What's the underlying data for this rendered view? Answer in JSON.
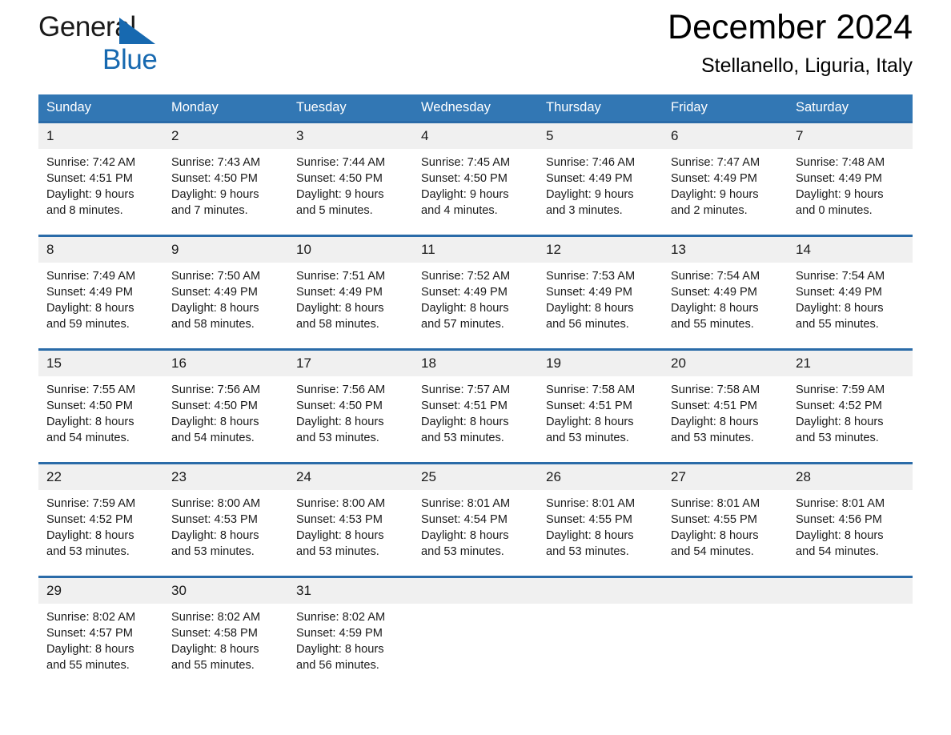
{
  "brand": {
    "name_top": "General",
    "name_bottom": "Blue",
    "triangle_color": "#1769b0",
    "text_color_top": "#1a1a1a",
    "text_color_bottom": "#1769b0"
  },
  "header": {
    "month_title": "December 2024",
    "location": "Stellanello, Liguria, Italy"
  },
  "theme": {
    "header_blue": "#3277b4",
    "cell_rule_blue": "#2a6ba8",
    "daynum_band": "#f0f0f0",
    "page_background": "#ffffff"
  },
  "calendar": {
    "weekday_headers": [
      "Sunday",
      "Monday",
      "Tuesday",
      "Wednesday",
      "Thursday",
      "Friday",
      "Saturday"
    ],
    "labels": {
      "sunrise_prefix": "Sunrise:",
      "sunset_prefix": "Sunset:",
      "daylight_prefix": "Daylight:"
    },
    "weeks": [
      [
        {
          "day": "1",
          "sunrise": "Sunrise: 7:42 AM",
          "sunset": "Sunset: 4:51 PM",
          "daylight_line1": "Daylight: 9 hours",
          "daylight_line2": "and 8 minutes."
        },
        {
          "day": "2",
          "sunrise": "Sunrise: 7:43 AM",
          "sunset": "Sunset: 4:50 PM",
          "daylight_line1": "Daylight: 9 hours",
          "daylight_line2": "and 7 minutes."
        },
        {
          "day": "3",
          "sunrise": "Sunrise: 7:44 AM",
          "sunset": "Sunset: 4:50 PM",
          "daylight_line1": "Daylight: 9 hours",
          "daylight_line2": "and 5 minutes."
        },
        {
          "day": "4",
          "sunrise": "Sunrise: 7:45 AM",
          "sunset": "Sunset: 4:50 PM",
          "daylight_line1": "Daylight: 9 hours",
          "daylight_line2": "and 4 minutes."
        },
        {
          "day": "5",
          "sunrise": "Sunrise: 7:46 AM",
          "sunset": "Sunset: 4:49 PM",
          "daylight_line1": "Daylight: 9 hours",
          "daylight_line2": "and 3 minutes."
        },
        {
          "day": "6",
          "sunrise": "Sunrise: 7:47 AM",
          "sunset": "Sunset: 4:49 PM",
          "daylight_line1": "Daylight: 9 hours",
          "daylight_line2": "and 2 minutes."
        },
        {
          "day": "7",
          "sunrise": "Sunrise: 7:48 AM",
          "sunset": "Sunset: 4:49 PM",
          "daylight_line1": "Daylight: 9 hours",
          "daylight_line2": "and 0 minutes."
        }
      ],
      [
        {
          "day": "8",
          "sunrise": "Sunrise: 7:49 AM",
          "sunset": "Sunset: 4:49 PM",
          "daylight_line1": "Daylight: 8 hours",
          "daylight_line2": "and 59 minutes."
        },
        {
          "day": "9",
          "sunrise": "Sunrise: 7:50 AM",
          "sunset": "Sunset: 4:49 PM",
          "daylight_line1": "Daylight: 8 hours",
          "daylight_line2": "and 58 minutes."
        },
        {
          "day": "10",
          "sunrise": "Sunrise: 7:51 AM",
          "sunset": "Sunset: 4:49 PM",
          "daylight_line1": "Daylight: 8 hours",
          "daylight_line2": "and 58 minutes."
        },
        {
          "day": "11",
          "sunrise": "Sunrise: 7:52 AM",
          "sunset": "Sunset: 4:49 PM",
          "daylight_line1": "Daylight: 8 hours",
          "daylight_line2": "and 57 minutes."
        },
        {
          "day": "12",
          "sunrise": "Sunrise: 7:53 AM",
          "sunset": "Sunset: 4:49 PM",
          "daylight_line1": "Daylight: 8 hours",
          "daylight_line2": "and 56 minutes."
        },
        {
          "day": "13",
          "sunrise": "Sunrise: 7:54 AM",
          "sunset": "Sunset: 4:49 PM",
          "daylight_line1": "Daylight: 8 hours",
          "daylight_line2": "and 55 minutes."
        },
        {
          "day": "14",
          "sunrise": "Sunrise: 7:54 AM",
          "sunset": "Sunset: 4:49 PM",
          "daylight_line1": "Daylight: 8 hours",
          "daylight_line2": "and 55 minutes."
        }
      ],
      [
        {
          "day": "15",
          "sunrise": "Sunrise: 7:55 AM",
          "sunset": "Sunset: 4:50 PM",
          "daylight_line1": "Daylight: 8 hours",
          "daylight_line2": "and 54 minutes."
        },
        {
          "day": "16",
          "sunrise": "Sunrise: 7:56 AM",
          "sunset": "Sunset: 4:50 PM",
          "daylight_line1": "Daylight: 8 hours",
          "daylight_line2": "and 54 minutes."
        },
        {
          "day": "17",
          "sunrise": "Sunrise: 7:56 AM",
          "sunset": "Sunset: 4:50 PM",
          "daylight_line1": "Daylight: 8 hours",
          "daylight_line2": "and 53 minutes."
        },
        {
          "day": "18",
          "sunrise": "Sunrise: 7:57 AM",
          "sunset": "Sunset: 4:51 PM",
          "daylight_line1": "Daylight: 8 hours",
          "daylight_line2": "and 53 minutes."
        },
        {
          "day": "19",
          "sunrise": "Sunrise: 7:58 AM",
          "sunset": "Sunset: 4:51 PM",
          "daylight_line1": "Daylight: 8 hours",
          "daylight_line2": "and 53 minutes."
        },
        {
          "day": "20",
          "sunrise": "Sunrise: 7:58 AM",
          "sunset": "Sunset: 4:51 PM",
          "daylight_line1": "Daylight: 8 hours",
          "daylight_line2": "and 53 minutes."
        },
        {
          "day": "21",
          "sunrise": "Sunrise: 7:59 AM",
          "sunset": "Sunset: 4:52 PM",
          "daylight_line1": "Daylight: 8 hours",
          "daylight_line2": "and 53 minutes."
        }
      ],
      [
        {
          "day": "22",
          "sunrise": "Sunrise: 7:59 AM",
          "sunset": "Sunset: 4:52 PM",
          "daylight_line1": "Daylight: 8 hours",
          "daylight_line2": "and 53 minutes."
        },
        {
          "day": "23",
          "sunrise": "Sunrise: 8:00 AM",
          "sunset": "Sunset: 4:53 PM",
          "daylight_line1": "Daylight: 8 hours",
          "daylight_line2": "and 53 minutes."
        },
        {
          "day": "24",
          "sunrise": "Sunrise: 8:00 AM",
          "sunset": "Sunset: 4:53 PM",
          "daylight_line1": "Daylight: 8 hours",
          "daylight_line2": "and 53 minutes."
        },
        {
          "day": "25",
          "sunrise": "Sunrise: 8:01 AM",
          "sunset": "Sunset: 4:54 PM",
          "daylight_line1": "Daylight: 8 hours",
          "daylight_line2": "and 53 minutes."
        },
        {
          "day": "26",
          "sunrise": "Sunrise: 8:01 AM",
          "sunset": "Sunset: 4:55 PM",
          "daylight_line1": "Daylight: 8 hours",
          "daylight_line2": "and 53 minutes."
        },
        {
          "day": "27",
          "sunrise": "Sunrise: 8:01 AM",
          "sunset": "Sunset: 4:55 PM",
          "daylight_line1": "Daylight: 8 hours",
          "daylight_line2": "and 54 minutes."
        },
        {
          "day": "28",
          "sunrise": "Sunrise: 8:01 AM",
          "sunset": "Sunset: 4:56 PM",
          "daylight_line1": "Daylight: 8 hours",
          "daylight_line2": "and 54 minutes."
        }
      ],
      [
        {
          "day": "29",
          "sunrise": "Sunrise: 8:02 AM",
          "sunset": "Sunset: 4:57 PM",
          "daylight_line1": "Daylight: 8 hours",
          "daylight_line2": "and 55 minutes."
        },
        {
          "day": "30",
          "sunrise": "Sunrise: 8:02 AM",
          "sunset": "Sunset: 4:58 PM",
          "daylight_line1": "Daylight: 8 hours",
          "daylight_line2": "and 55 minutes."
        },
        {
          "day": "31",
          "sunrise": "Sunrise: 8:02 AM",
          "sunset": "Sunset: 4:59 PM",
          "daylight_line1": "Daylight: 8 hours",
          "daylight_line2": "and 56 minutes."
        },
        {
          "day": "",
          "sunrise": "",
          "sunset": "",
          "daylight_line1": "",
          "daylight_line2": ""
        },
        {
          "day": "",
          "sunrise": "",
          "sunset": "",
          "daylight_line1": "",
          "daylight_line2": ""
        },
        {
          "day": "",
          "sunrise": "",
          "sunset": "",
          "daylight_line1": "",
          "daylight_line2": ""
        },
        {
          "day": "",
          "sunrise": "",
          "sunset": "",
          "daylight_line1": "",
          "daylight_line2": ""
        }
      ]
    ]
  }
}
